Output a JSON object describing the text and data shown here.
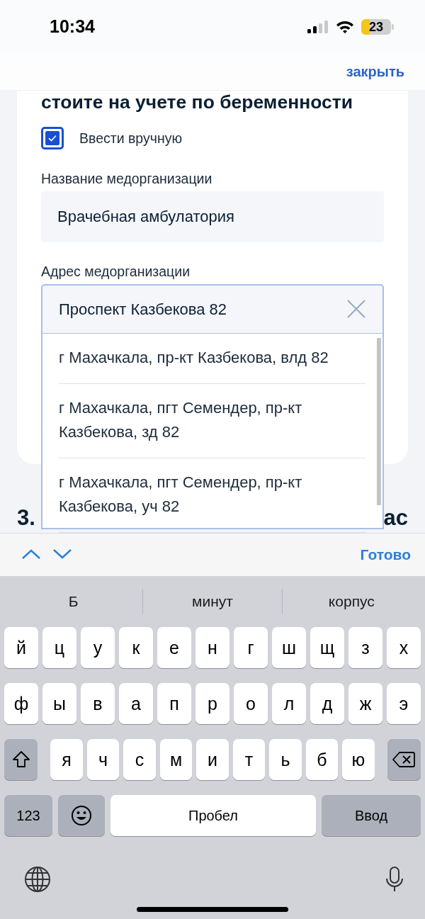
{
  "status_bar": {
    "time": "10:34",
    "battery": "23"
  },
  "header": {
    "close_link": "закрыть"
  },
  "form": {
    "title": "стоите на учете по беременности",
    "manual_checkbox": {
      "label": "Ввести вручную",
      "checked": true
    },
    "org_name": {
      "label": "Название медорганизации",
      "value": "Врачебная амбулатория"
    },
    "org_address": {
      "label": "Адрес медорганизации",
      "value": "Проспект Казбекова 82",
      "suggestions": [
        "г Махачкала, пр-кт Казбекова, влд 82",
        "г Махачкала, пгт Семендер, пр-кт Казбекова, зд 82",
        "г Махачкала, пгт Семендер, пр-кт Казбекова, уч 82"
      ]
    }
  },
  "next_section": {
    "number": "3.",
    "title_end": "ас"
  },
  "keyboard_toolbar": {
    "done": "Готово"
  },
  "keyboard": {
    "suggestions": [
      "Б",
      "минут",
      "корпус"
    ],
    "letter_rows": [
      [
        "й",
        "ц",
        "у",
        "к",
        "е",
        "н",
        "г",
        "ш",
        "щ",
        "з",
        "х"
      ],
      [
        "ф",
        "ы",
        "в",
        "а",
        "п",
        "р",
        "о",
        "л",
        "д",
        "ж",
        "э"
      ],
      [
        "я",
        "ч",
        "с",
        "м",
        "и",
        "т",
        "ь",
        "б",
        "ю"
      ]
    ],
    "number_key": "123",
    "space_key": "Пробел",
    "return_key": "Ввод"
  }
}
